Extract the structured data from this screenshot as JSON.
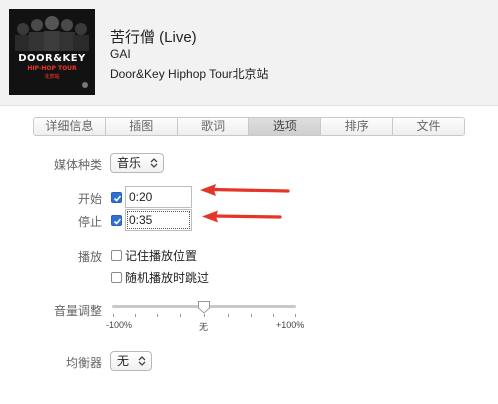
{
  "track": {
    "title": "苦行僧 (Live)",
    "artist": "GAI",
    "album": "Door&Key Hiphop Tour北京站",
    "artwork": {
      "line1": "DOOR&KEY",
      "line2": "HIP-HOP TOUR",
      "line3": "北京站"
    }
  },
  "tabs": [
    {
      "label": "详细信息",
      "active": false
    },
    {
      "label": "插图",
      "active": false
    },
    {
      "label": "歌词",
      "active": false
    },
    {
      "label": "选项",
      "active": true
    },
    {
      "label": "排序",
      "active": false
    },
    {
      "label": "文件",
      "active": false
    }
  ],
  "options": {
    "media_kind": {
      "label": "媒体种类",
      "value": "音乐"
    },
    "start": {
      "label": "开始",
      "checked": true,
      "value": "0:20"
    },
    "stop": {
      "label": "停止",
      "checked": true,
      "value": "0:35"
    },
    "playback": {
      "label": "播放",
      "remember_position": {
        "label": "记住播放位置",
        "checked": false
      },
      "skip_shuffle": {
        "label": "随机播放时跳过",
        "checked": false
      }
    },
    "volume": {
      "label": "音量调整",
      "min_label": "-100%",
      "mid_label": "无",
      "max_label": "+100%",
      "value_percent": 0
    },
    "equalizer": {
      "label": "均衡器",
      "value": "无"
    }
  },
  "colors": {
    "annotation_arrow": "#e53528",
    "checkbox_accent": "#2f6fd6"
  }
}
